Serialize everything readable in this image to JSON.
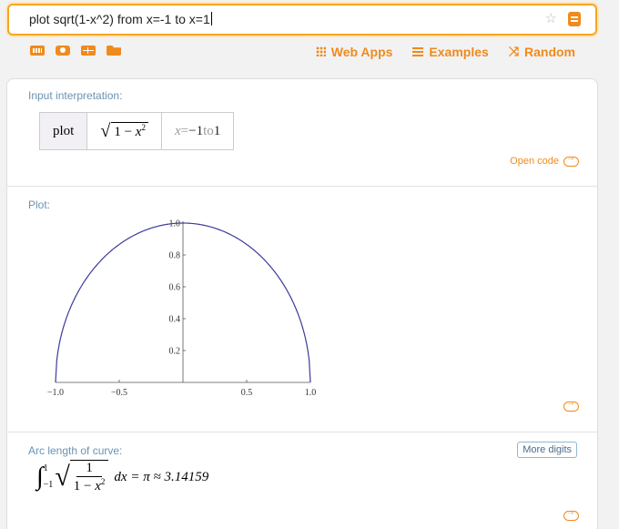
{
  "search": {
    "query": "plot sqrt(1-x^2) from x=-1 to x=1"
  },
  "toolbar": {
    "links": [
      {
        "label": "Web Apps",
        "icon": "grid-icon"
      },
      {
        "label": "Examples",
        "icon": "list-icon"
      },
      {
        "label": "Random",
        "icon": "shuffle-icon"
      }
    ]
  },
  "colors": {
    "accent": "#f08a1c",
    "pod_title": "#6a93b3",
    "curve": "#3b3b9a"
  },
  "pods": {
    "input": {
      "title": "Input interpretation:",
      "keyword": "plot",
      "range_var": "x",
      "range_eq": " = ",
      "range_from": "−1",
      "range_to_word": " to ",
      "range_to": "1",
      "open_code": "Open code"
    },
    "plot": {
      "title": "Plot:"
    },
    "arc": {
      "title": "Arc length of curve:",
      "more_digits": "More digits",
      "result": "dx = π ≈ 3.14159"
    }
  },
  "chart_data": {
    "type": "line",
    "function": "sqrt(1-x^2)",
    "x": [
      -1.0,
      -0.9,
      -0.8,
      -0.7,
      -0.6,
      -0.5,
      -0.4,
      -0.3,
      -0.2,
      -0.1,
      0.0,
      0.1,
      0.2,
      0.3,
      0.4,
      0.5,
      0.6,
      0.7,
      0.8,
      0.9,
      1.0
    ],
    "y": [
      0.0,
      0.436,
      0.6,
      0.714,
      0.8,
      0.866,
      0.917,
      0.954,
      0.98,
      0.995,
      1.0,
      0.995,
      0.98,
      0.954,
      0.917,
      0.866,
      0.8,
      0.714,
      0.6,
      0.436,
      0.0
    ],
    "xlim": [
      -1.0,
      1.0
    ],
    "ylim": [
      0.0,
      1.0
    ],
    "xticks": [
      "−1.0",
      "−0.5",
      "0.5",
      "1.0"
    ],
    "yticks": [
      "0.2",
      "0.4",
      "0.6",
      "0.8",
      "1.0"
    ]
  }
}
